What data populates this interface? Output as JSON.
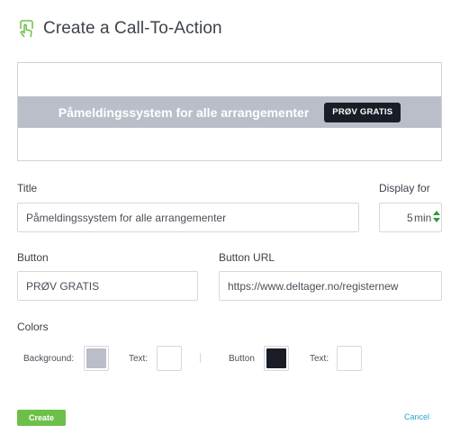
{
  "header": {
    "title": "Create a Call-To-Action",
    "icon": "hand-pointer-icon"
  },
  "preview": {
    "bar_text": "Påmeldingssystem for alle arrangementer",
    "button_text": "PRØV GRATIS",
    "bar_color": "#babec8",
    "button_color": "#1a1d26"
  },
  "form": {
    "title_label": "Title",
    "title_value": "Påmeldingssystem for alle arrangementer",
    "display_label": "Display for",
    "display_value": "5",
    "display_unit": "min",
    "button_label": "Button",
    "button_value": "PRØV GRATIS",
    "button_url_label": "Button URL",
    "button_url_value": "https://www.deltager.no/registernew"
  },
  "colors": {
    "section_label": "Colors",
    "background_label": "Background:",
    "background_color": "#babec8",
    "text_label": "Text:",
    "text_color": "#ffffff",
    "button_label": "Button",
    "button_color": "#1a1d26",
    "button_text_label": "Text:",
    "button_text_color": "#ffffff"
  },
  "actions": {
    "create_label": "Create",
    "cancel_label": "Cancel"
  }
}
